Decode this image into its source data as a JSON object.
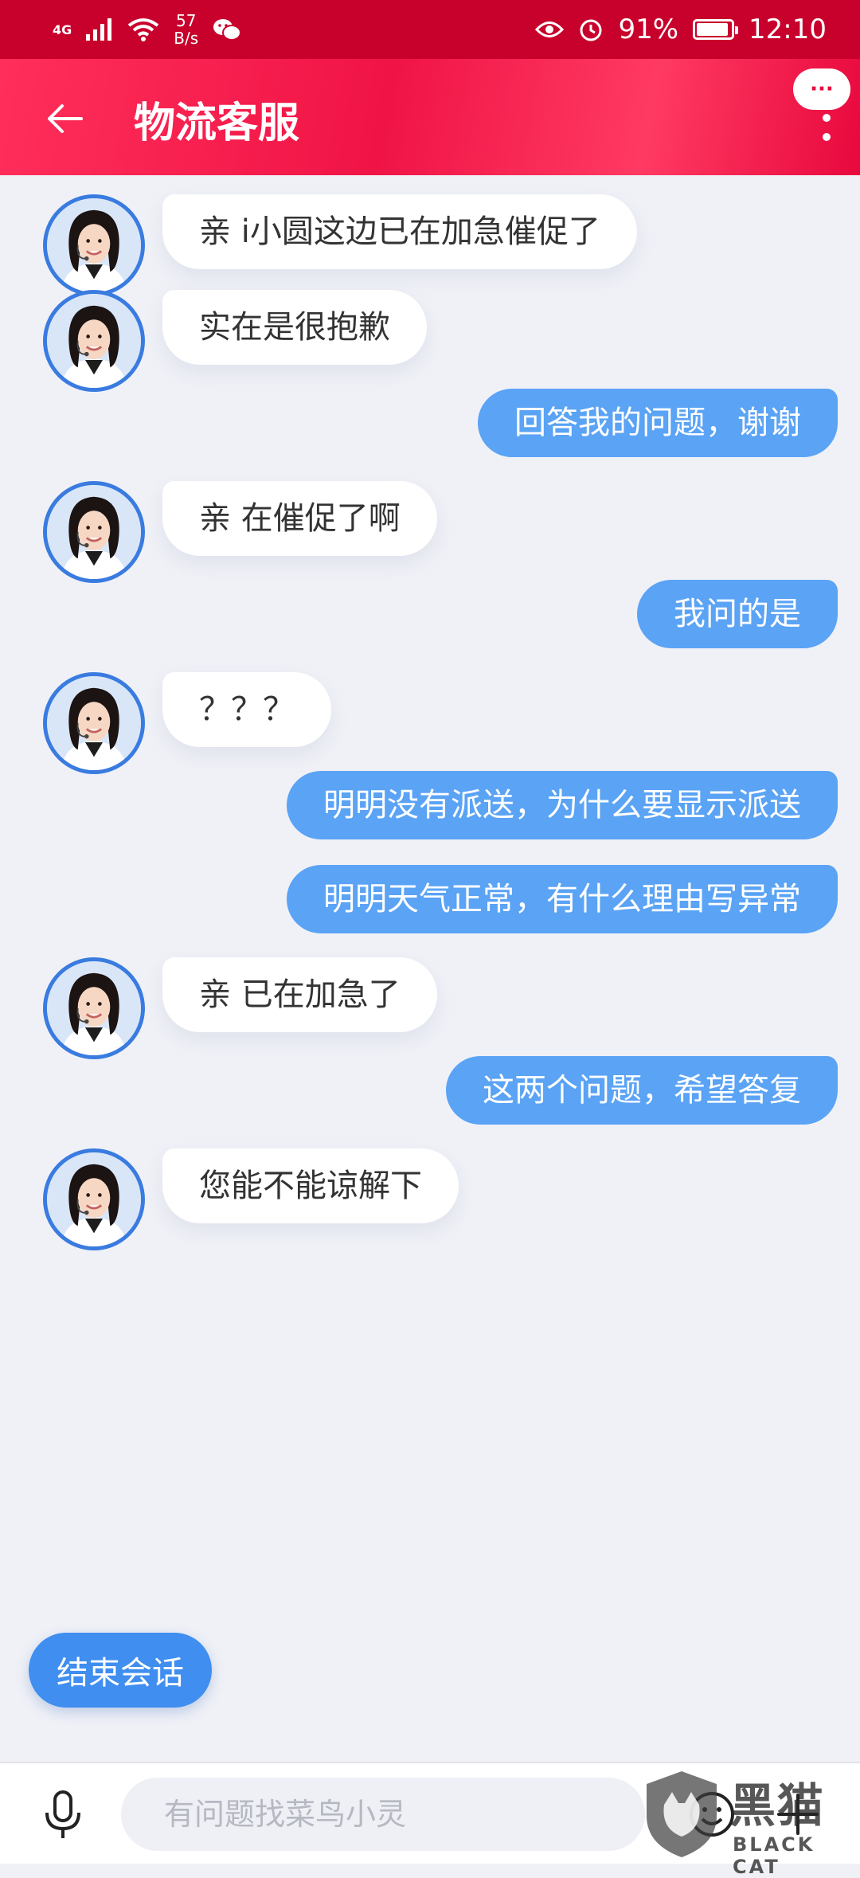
{
  "status_bar": {
    "network": "4G",
    "speed_value": "57",
    "speed_unit": "B/s",
    "battery": "91%",
    "time": "12:10",
    "icons": [
      "signal-icon",
      "wifi-icon",
      "wechat-icon",
      "eye-icon",
      "alarm-icon",
      "battery-icon"
    ]
  },
  "header": {
    "title": "物流客服",
    "more_label": "···",
    "accent": "#f01446"
  },
  "messages": [
    {
      "side": "left",
      "text": "亲 i小圆这边已在加急催促了"
    },
    {
      "side": "left",
      "text": "实在是很抱歉"
    },
    {
      "side": "right",
      "text": "回答我的问题，谢谢"
    },
    {
      "side": "left",
      "text": "亲 在催促了啊"
    },
    {
      "side": "right",
      "text": "我问的是"
    },
    {
      "side": "left",
      "text": "？？？"
    },
    {
      "side": "right",
      "text": "明明没有派送，为什么要显示派送"
    },
    {
      "side": "right",
      "text": "明明天气正常，有什么理由写异常"
    },
    {
      "side": "left",
      "text": "亲 已在加急了"
    },
    {
      "side": "right",
      "text": "这两个问题，希望答复"
    },
    {
      "side": "left",
      "text": "您能不能谅解下"
    }
  ],
  "end_session": {
    "label": "结束会话"
  },
  "input": {
    "placeholder": "有问题找菜鸟小灵",
    "value": ""
  },
  "watermark": {
    "text": "黑猫",
    "sub": "BLACK CAT"
  },
  "colors": {
    "user_bubble": "#5aa3f5",
    "agent_bubble": "#ffffff",
    "status_bar": "#c8002c"
  }
}
